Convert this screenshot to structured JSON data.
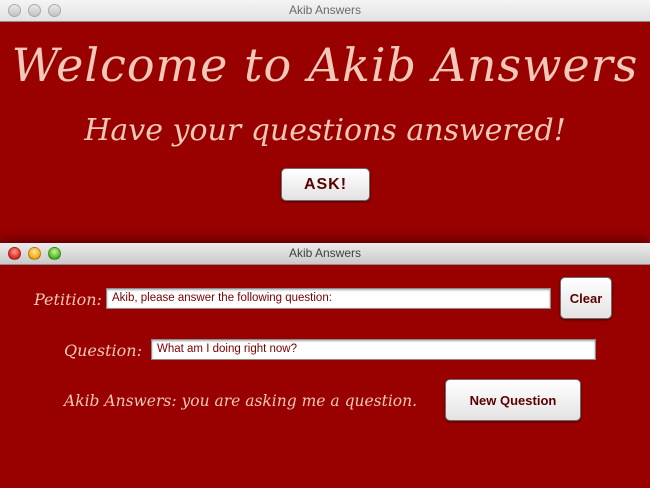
{
  "back_window": {
    "title": "Akib Answers",
    "welcome_text": "Welcome to Akib Answers",
    "subtitle": "Have your questions answered!",
    "ask_button": "ASK!"
  },
  "front_window": {
    "title": "Akib Answers",
    "petition": {
      "label": "Petition:",
      "value": "Akib, please answer the following question:"
    },
    "clear_button": "Clear",
    "question": {
      "label": "Question:",
      "value": "What am I doing right now?"
    },
    "answer_text": "Akib Answers: you are asking me a question.",
    "new_question_button": "New Question"
  },
  "colors": {
    "background": "#990000",
    "text": "#f2c8b8",
    "button_text": "#5a0000"
  }
}
